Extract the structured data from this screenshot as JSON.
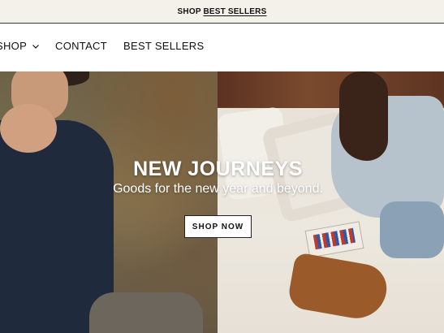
{
  "announcement": {
    "prefix": "SHOP ",
    "link_text": "BEST SELLERS"
  },
  "nav": {
    "items": [
      {
        "label": "SHOP"
      },
      {
        "label": "CONTACT"
      },
      {
        "label": "BEST SELLERS"
      }
    ]
  },
  "hero": {
    "title": "NEW JOURNEYS",
    "subtitle": "Goods for the new year and beyond.",
    "cta_label": "SHOP NOW"
  },
  "colors": {
    "announcement_bg": "#f3f1ea",
    "text": "#111111",
    "hero_text": "#ffffff"
  },
  "icons": {
    "shop_dropdown": "chevron-down-icon"
  }
}
